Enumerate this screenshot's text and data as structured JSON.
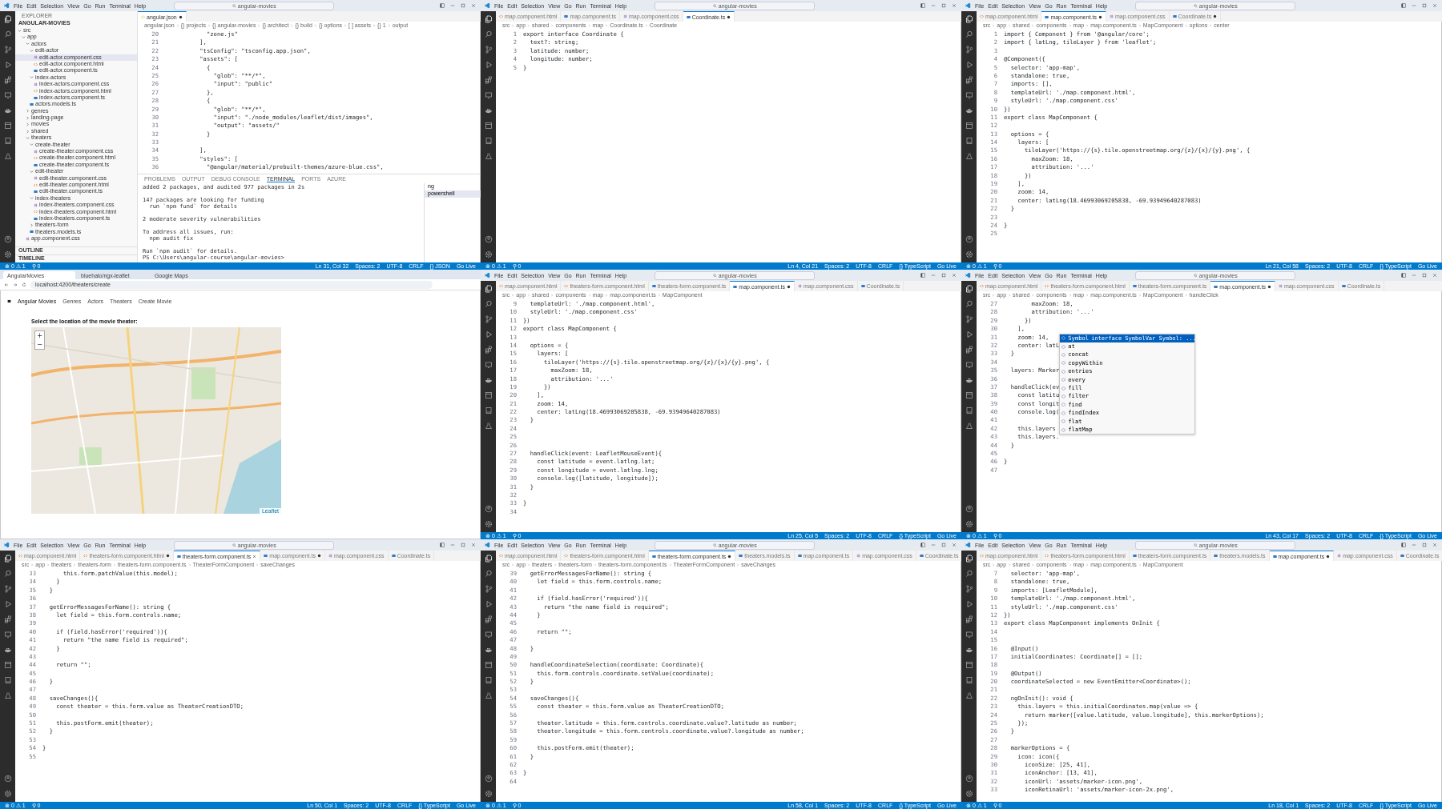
{
  "panels": [
    {
      "kind": "editor",
      "menu": [
        "File",
        "Edit",
        "Selection",
        "View",
        "Go",
        "Run",
        "Terminal",
        "Help"
      ],
      "command_center": "angular-movies",
      "tabs": [
        {
          "label": "angular.json",
          "kind": "json",
          "selected": true,
          "modified": true
        }
      ],
      "breadcrumb": [
        "angular.json",
        "{} projects",
        "{} angular-movies",
        "{} architect",
        "{} build",
        "{} options",
        "[ ] assets",
        "{} 1",
        "output"
      ],
      "explorer": {
        "title": "EXPLORER",
        "section": "ANGULAR-MOVIES",
        "tree": [
          {
            "name": "src",
            "kind": "folder",
            "expanded": true,
            "selected": false,
            "children": [
              {
                "name": "app",
                "kind": "folder",
                "expanded": true,
                "selected": false,
                "children": [
                  {
                    "name": "actors",
                    "kind": "folder",
                    "expanded": true,
                    "selected": false,
                    "children": [
                      {
                        "name": "edit-actor",
                        "kind": "folder",
                        "expanded": true,
                        "selected": false,
                        "children": [
                          {
                            "name": "edit-actor.component.css",
                            "kind": "css",
                            "selected": true
                          },
                          {
                            "name": "edit-actor.component.html",
                            "kind": "html",
                            "selected": false
                          },
                          {
                            "name": "edit-actor.component.ts",
                            "kind": "ts",
                            "selected": false
                          }
                        ]
                      },
                      {
                        "name": "index-actors",
                        "kind": "folder",
                        "expanded": true,
                        "selected": false,
                        "children": [
                          {
                            "name": "index-actors.component.css",
                            "kind": "css",
                            "selected": false
                          },
                          {
                            "name": "index-actors.component.html",
                            "kind": "html",
                            "selected": false
                          },
                          {
                            "name": "index-actors.component.ts",
                            "kind": "ts",
                            "selected": false
                          }
                        ]
                      },
                      {
                        "name": "actors.models.ts",
                        "kind": "ts",
                        "selected": false
                      }
                    ]
                  },
                  {
                    "name": "genres",
                    "kind": "folder",
                    "expanded": false,
                    "selected": false
                  },
                  {
                    "name": "landing-page",
                    "kind": "folder",
                    "expanded": false,
                    "selected": false
                  },
                  {
                    "name": "movies",
                    "kind": "folder",
                    "expanded": false,
                    "selected": false
                  },
                  {
                    "name": "shared",
                    "kind": "folder",
                    "expanded": false,
                    "selected": false
                  },
                  {
                    "name": "theaters",
                    "kind": "folder",
                    "expanded": true,
                    "selected": false,
                    "children": [
                      {
                        "name": "create-theater",
                        "kind": "folder",
                        "expanded": true,
                        "selected": false,
                        "children": [
                          {
                            "name": "create-theater.component.css",
                            "kind": "css",
                            "selected": false
                          },
                          {
                            "name": "create-theater.component.html",
                            "kind": "html",
                            "selected": false
                          },
                          {
                            "name": "create-theater.component.ts",
                            "kind": "ts",
                            "selected": false
                          }
                        ]
                      },
                      {
                        "name": "edit-theater",
                        "kind": "folder",
                        "expanded": true,
                        "selected": false,
                        "children": [
                          {
                            "name": "edit-theater.component.css",
                            "kind": "css",
                            "selected": false
                          },
                          {
                            "name": "edit-theater.component.html",
                            "kind": "html",
                            "selected": false
                          },
                          {
                            "name": "edit-theater.component.ts",
                            "kind": "ts",
                            "selected": false
                          }
                        ]
                      },
                      {
                        "name": "index-theaters",
                        "kind": "folder",
                        "expanded": true,
                        "selected": false,
                        "children": [
                          {
                            "name": "index-theaters.component.css",
                            "kind": "css",
                            "selected": false
                          },
                          {
                            "name": "index-theaters.component.html",
                            "kind": "html",
                            "selected": false
                          },
                          {
                            "name": "index-theaters.component.ts",
                            "kind": "ts",
                            "selected": false
                          }
                        ]
                      },
                      {
                        "name": "theaters-form",
                        "kind": "folder",
                        "expanded": false,
                        "selected": false
                      },
                      {
                        "name": "theaters.models.ts",
                        "kind": "ts",
                        "selected": false
                      }
                    ]
                  },
                  {
                    "name": "app.component.css",
                    "kind": "css",
                    "selected": false
                  }
                ]
              }
            ]
          }
        ],
        "footer": [
          "OUTLINE",
          "TIMELINE"
        ]
      },
      "lines": [
        {
          "n": "20",
          "code": "            \"zone.js\""
        },
        {
          "n": "21",
          "code": "          ],"
        },
        {
          "n": "22",
          "code": "          \"tsConfig\": \"tsconfig.app.json\","
        },
        {
          "n": "23",
          "code": "          \"assets\": ["
        },
        {
          "n": "24",
          "code": "            {"
        },
        {
          "n": "25",
          "code": "              \"glob\": \"**/*\","
        },
        {
          "n": "26",
          "code": "              \"input\": \"public\""
        },
        {
          "n": "27",
          "code": "            },"
        },
        {
          "n": "28",
          "code": "            {"
        },
        {
          "n": "29",
          "code": "              \"glob\": \"**/*\","
        },
        {
          "n": "30",
          "code": "              \"input\": \"./node_modules/leaflet/dist/images\","
        },
        {
          "n": "31",
          "code": "              \"output\": \"assets/\""
        },
        {
          "n": "32",
          "code": "            }"
        },
        {
          "n": "33"
        },
        {
          "n": "34",
          "code": "          ],"
        },
        {
          "n": "35",
          "code": "          \"styles\": ["
        },
        {
          "n": "36",
          "code": "            \"@angular/material/prebuilt-themes/azure-blue.css\","
        }
      ],
      "terminal": {
        "tabs": [
          {
            "label": "PROBLEMS",
            "selected": false
          },
          {
            "label": "OUTPUT",
            "selected": false
          },
          {
            "label": "DEBUG CONSOLE",
            "selected": false
          },
          {
            "label": "TERMINAL",
            "selected": true
          },
          {
            "label": "PORTS",
            "selected": false
          },
          {
            "label": "AZURE",
            "selected": false
          }
        ],
        "blocks": [
          [
            "added 2 packages, and audited 977 packages in 2s"
          ],
          [
            "147 packages are looking for funding",
            "  run `npm fund` for details"
          ],
          [
            "2 moderate severity vulnerabilities"
          ],
          [
            "To address all issues, run:",
            "  npm audit fix"
          ],
          [
            "Run `npm audit` for details.",
            "PS C:\\Users\\angular-course\\angular-movies> "
          ]
        ],
        "sessions": [
          {
            "label": "ng",
            "selected": false
          },
          {
            "label": "powershell",
            "selected": true
          }
        ]
      },
      "status_left": [
        "⊗ 0 ⚠ 1",
        "⚲ 0"
      ],
      "status_right": [
        "Ln 31, Col 32",
        "Spaces: 2",
        "UTF-8",
        "CRLF",
        "{} JSON",
        "Go Live"
      ]
    },
    {
      "kind": "editor",
      "menu": [
        "File",
        "Edit",
        "Selection",
        "View",
        "Go",
        "Run",
        "Terminal",
        "Help"
      ],
      "command_center": "angular-movies",
      "tabs": [
        {
          "label": "map.component.html",
          "kind": "html",
          "selected": false,
          "modified": false
        },
        {
          "label": "map.component.ts",
          "kind": "ts",
          "selected": false,
          "modified": false
        },
        {
          "label": "map.component.css",
          "kind": "css",
          "selected": false,
          "modified": false
        },
        {
          "label": "Coordinate.ts",
          "kind": "ts",
          "selected": true,
          "modified": true
        }
      ],
      "breadcrumb": [
        "src",
        "app",
        "shared",
        "components",
        "map",
        "Coordinate.ts",
        "Coordinate"
      ],
      "lines": [
        {
          "n": "1",
          "code": "export interface Coordinate {"
        },
        {
          "n": "2",
          "code": "  text?: string;"
        },
        {
          "n": "3",
          "code": "  latitude: number;"
        },
        {
          "n": "4",
          "code": "  longitude: number;"
        },
        {
          "n": "5",
          "code": "}"
        }
      ],
      "status_left": [
        "⊗ 0 ⚠ 1",
        "⚲ 0"
      ],
      "status_right": [
        "Ln 4, Col 21",
        "Spaces: 2",
        "UTF-8",
        "CRLF",
        "{} TypeScript",
        "Go Live"
      ]
    },
    {
      "kind": "editor",
      "menu": [
        "File",
        "Edit",
        "Selection",
        "View",
        "Go",
        "Run",
        "Terminal",
        "Help"
      ],
      "command_center": "angular-movies",
      "tabs": [
        {
          "label": "map.component.html",
          "kind": "html",
          "selected": false,
          "modified": false
        },
        {
          "label": "map.component.ts",
          "kind": "ts",
          "selected": true,
          "modified": true
        },
        {
          "label": "map.component.css",
          "kind": "css",
          "selected": false,
          "modified": false
        },
        {
          "label": "Coordinate.ts",
          "kind": "ts",
          "selected": false,
          "modified": true
        }
      ],
      "breadcrumb": [
        "src",
        "app",
        "shared",
        "components",
        "map",
        "map.component.ts",
        "MapComponent",
        "options",
        "center"
      ],
      "lines": [
        {
          "n": "1",
          "code": "import { Component } from '@angular/core';"
        },
        {
          "n": "2",
          "code": "import { latLng, tileLayer } from 'leaflet';"
        },
        {
          "n": "3"
        },
        {
          "n": "4",
          "code": "@Component({"
        },
        {
          "n": "5",
          "code": "  selector: 'app-map',"
        },
        {
          "n": "6",
          "code": "  standalone: true,"
        },
        {
          "n": "7",
          "code": "  imports: [],"
        },
        {
          "n": "8",
          "code": "  templateUrl: './map.component.html',"
        },
        {
          "n": "9",
          "code": "  styleUrl: './map.component.css'"
        },
        {
          "n": "10",
          "code": "})"
        },
        {
          "n": "11",
          "code": "export class MapComponent {"
        },
        {
          "n": "12"
        },
        {
          "n": "13",
          "code": "  options = {"
        },
        {
          "n": "14",
          "code": "    layers: ["
        },
        {
          "n": "15",
          "code": "      tileLayer('https://{s}.tile.openstreetmap.org/{z}/{x}/{y}.png', {"
        },
        {
          "n": "16",
          "code": "        maxZoom: 18,"
        },
        {
          "n": "17",
          "code": "        attribution: '...'"
        },
        {
          "n": "18",
          "code": "      })"
        },
        {
          "n": "19",
          "code": "    ],"
        },
        {
          "n": "20",
          "code": "    zoom: 14,"
        },
        {
          "n": "21",
          "code": "    center: latLng(18.46993069205838, -69.93949640287083)"
        },
        {
          "n": "22",
          "code": "  }"
        },
        {
          "n": "23"
        },
        {
          "n": "24",
          "code": "}"
        },
        {
          "n": "25"
        }
      ],
      "status_left": [
        "⊗ 0 ⚠ 1",
        "⚲ 0"
      ],
      "status_right": [
        "Ln 21, Col 58",
        "Spaces: 2",
        "UTF-8",
        "CRLF",
        "{} TypeScript",
        "Go Live"
      ]
    },
    {
      "kind": "browser",
      "tabs": [
        {
          "label": "AngularMovies",
          "selected": true
        },
        {
          "label": "bluehalo/ngx-leaflet",
          "selected": false
        },
        {
          "label": "Google Maps",
          "selected": false
        }
      ],
      "address": "localhost:4200/theaters/create",
      "nav": [
        "Angular Movies",
        "Genres",
        "Actors",
        "Theaters",
        "Create Movie"
      ],
      "heading": "Select the location of the movie theater:",
      "map": {
        "kind": "picture",
        "zoom_in": "+",
        "zoom_out": "−",
        "attribution": "Leaflet"
      }
    },
    {
      "kind": "editor",
      "menu": [
        "File",
        "Edit",
        "Selection",
        "View",
        "Go",
        "Run",
        "Terminal",
        "Help"
      ],
      "command_center": "angular-movies",
      "tabs": [
        {
          "label": "map.component.html",
          "kind": "html",
          "selected": false,
          "modified": false
        },
        {
          "label": "theaters-form.component.html",
          "kind": "html",
          "selected": false,
          "modified": false
        },
        {
          "label": "theaters-form.component.ts",
          "kind": "ts",
          "selected": false,
          "modified": false
        },
        {
          "label": "map.component.ts",
          "kind": "ts",
          "selected": true,
          "modified": true
        },
        {
          "label": "map.component.css",
          "kind": "css",
          "selected": false,
          "modified": false
        },
        {
          "label": "Coordinate.ts",
          "kind": "ts",
          "selected": false,
          "modified": false
        }
      ],
      "breadcrumb": [
        "src",
        "app",
        "shared",
        "components",
        "map",
        "map.component.ts",
        "MapComponent"
      ],
      "lines": [
        {
          "n": "9",
          "code": "  templateUrl: './map.component.html',"
        },
        {
          "n": "10",
          "code": "  styleUrl: './map.component.css'"
        },
        {
          "n": "11",
          "code": "})"
        },
        {
          "n": "12",
          "code": "export class MapComponent {"
        },
        {
          "n": "13"
        },
        {
          "n": "14",
          "code": "  options = {"
        },
        {
          "n": "15",
          "code": "    layers: ["
        },
        {
          "n": "16",
          "code": "      tileLayer('https://{s}.tile.openstreetmap.org/{z}/{x}/{y}.png', {"
        },
        {
          "n": "17",
          "code": "        maxZoom: 18,"
        },
        {
          "n": "18",
          "code": "        attribution: '...'"
        },
        {
          "n": "19",
          "code": "      })"
        },
        {
          "n": "20",
          "code": "    ],"
        },
        {
          "n": "21",
          "code": "    zoom: 14,"
        },
        {
          "n": "22",
          "code": "    center: latLng(18.46993069205838, -69.93949640287083)"
        },
        {
          "n": "23",
          "code": "  }"
        },
        {
          "n": "24"
        },
        {
          "n": "25"
        },
        {
          "n": "26"
        },
        {
          "n": "27",
          "code": "  handleClick(event: LeafletMouseEvent){"
        },
        {
          "n": "28",
          "code": "    const latitude = event.latlng.lat;"
        },
        {
          "n": "29",
          "code": "    const longitude = event.latlng.lng;"
        },
        {
          "n": "30",
          "code": "    console.log([latitude, longitude]);"
        },
        {
          "n": "31",
          "code": "  }"
        },
        {
          "n": "32"
        },
        {
          "n": "33",
          "code": "}"
        },
        {
          "n": "34"
        }
      ],
      "status_left": [
        "⊗ 0 ⚠ 1",
        "⚲ 0"
      ],
      "status_right": [
        "Ln 25, Col 5",
        "Spaces: 2",
        "UTF-8",
        "CRLF",
        "{} TypeScript",
        "Go Live"
      ]
    },
    {
      "kind": "editor",
      "menu": [
        "File",
        "Edit",
        "Selection",
        "View",
        "Go",
        "Run",
        "Terminal",
        "Help"
      ],
      "command_center": "angular-movies",
      "tabs": [
        {
          "label": "map.component.html",
          "kind": "html",
          "selected": false,
          "modified": false
        },
        {
          "label": "theaters-form.component.html",
          "kind": "html",
          "selected": false,
          "modified": false
        },
        {
          "label": "theaters-form.component.ts",
          "kind": "ts",
          "selected": false,
          "modified": false
        },
        {
          "label": "map.component.ts",
          "kind": "ts",
          "selected": true,
          "modified": true
        },
        {
          "label": "map.component.css",
          "kind": "css",
          "selected": false,
          "modified": false
        },
        {
          "label": "Coordinate.ts",
          "kind": "ts",
          "selected": false,
          "modified": false
        }
      ],
      "breadcrumb": [
        "src",
        "app",
        "shared",
        "components",
        "map",
        "map.component.ts",
        "MapComponent",
        "handleClick"
      ],
      "lines": [
        {
          "n": "27",
          "code": "        maxZoom: 18,"
        },
        {
          "n": "28",
          "code": "        attribution: '...'"
        },
        {
          "n": "29",
          "code": "      })"
        },
        {
          "n": "30",
          "code": "    ],"
        },
        {
          "n": "31",
          "code": "    zoom: 14,"
        },
        {
          "n": "32",
          "code": "    center: latL"
        },
        {
          "n": "33",
          "code": "  }"
        },
        {
          "n": "34"
        },
        {
          "n": "35",
          "code": "  layers: Marker"
        },
        {
          "n": "36"
        },
        {
          "n": "37",
          "code": "  handleClick(ev"
        },
        {
          "n": "38",
          "code": "    const latitu"
        },
        {
          "n": "39",
          "code": "    const longit"
        },
        {
          "n": "40",
          "code": "    console.log("
        },
        {
          "n": "41"
        },
        {
          "n": "42",
          "code": "    this.layers"
        },
        {
          "n": "43",
          "code": "    this.layers."
        },
        {
          "n": "44",
          "code": "  }"
        },
        {
          "n": "45"
        },
        {
          "n": "46",
          "code": "}"
        },
        {
          "n": "47"
        }
      ],
      "suggest": {
        "detail": "interface SymbolVar Symbol: ...",
        "items": [
          {
            "label": "Symbol",
            "selected": true
          },
          {
            "label": "at",
            "selected": false
          },
          {
            "label": "concat",
            "selected": false
          },
          {
            "label": "copyWithin",
            "selected": false
          },
          {
            "label": "entries",
            "selected": false
          },
          {
            "label": "every",
            "selected": false
          },
          {
            "label": "fill",
            "selected": false
          },
          {
            "label": "filter",
            "selected": false
          },
          {
            "label": "find",
            "selected": false
          },
          {
            "label": "findIndex",
            "selected": false
          },
          {
            "label": "flat",
            "selected": false
          },
          {
            "label": "flatMap",
            "selected": false
          }
        ]
      },
      "status_left": [
        "⊗ 0 ⚠ 1",
        "⚲ 0"
      ],
      "status_right": [
        "Ln 43, Col 17",
        "Spaces: 2",
        "UTF-8",
        "CRLF",
        "{} TypeScript",
        "Go Live"
      ]
    },
    {
      "kind": "editor",
      "menu": [
        "File",
        "Edit",
        "Selection",
        "View",
        "Go",
        "Run",
        "Terminal",
        "Help"
      ],
      "command_center": "angular-movies",
      "tabs": [
        {
          "label": "map.component.html",
          "kind": "html",
          "selected": false,
          "modified": false
        },
        {
          "label": "theaters-form.component.html",
          "kind": "html",
          "selected": false,
          "modified": true
        },
        {
          "label": "theaters-form.component.ts",
          "kind": "ts",
          "selected": true,
          "modified": false
        },
        {
          "label": "map.component.ts",
          "kind": "ts",
          "selected": false,
          "modified": true
        },
        {
          "label": "map.component.css",
          "kind": "css",
          "selected": false,
          "modified": false
        },
        {
          "label": "Coordinate.ts",
          "kind": "ts",
          "selected": false,
          "modified": false
        }
      ],
      "breadcrumb": [
        "src",
        "app",
        "theaters",
        "theaters-form",
        "theaters-form.component.ts",
        "TheaterFormComponent",
        "saveChanges"
      ],
      "lines": [
        {
          "n": "33",
          "code": "      this.form.patchValue(this.model);"
        },
        {
          "n": "34",
          "code": "    }"
        },
        {
          "n": "35",
          "code": "  }"
        },
        {
          "n": "36"
        },
        {
          "n": "37",
          "code": "  getErrorMessagesForName(): string {"
        },
        {
          "n": "38",
          "code": "    let field = this.form.controls.name;"
        },
        {
          "n": "39"
        },
        {
          "n": "40",
          "code": "    if (field.hasError('required')){"
        },
        {
          "n": "41",
          "code": "      return \"the name field is required\";"
        },
        {
          "n": "42",
          "code": "    }"
        },
        {
          "n": "43"
        },
        {
          "n": "44",
          "code": "    return \"\";"
        },
        {
          "n": "45"
        },
        {
          "n": "46",
          "code": "  }"
        },
        {
          "n": "47"
        },
        {
          "n": "48",
          "code": "  saveChanges(){"
        },
        {
          "n": "49",
          "code": "    const theater = this.form.value as TheaterCreationDTO;"
        },
        {
          "n": "50"
        },
        {
          "n": "51",
          "code": "    this.postForm.emit(theater);"
        },
        {
          "n": "52",
          "code": "  }"
        },
        {
          "n": "53"
        },
        {
          "n": "54",
          "code": "}"
        },
        {
          "n": "55"
        }
      ],
      "status_left": [
        "⊗ 0 ⚠ 1",
        "⚲ 0"
      ],
      "status_right": [
        "Ln 50, Col 1",
        "Spaces: 2",
        "UTF-8",
        "CRLF",
        "{} TypeScript",
        "Go Live"
      ]
    },
    {
      "kind": "editor",
      "menu": [
        "File",
        "Edit",
        "Selection",
        "View",
        "Go",
        "Run",
        "Terminal",
        "Help"
      ],
      "command_center": "angular-movies",
      "tabs": [
        {
          "label": "map.component.html",
          "kind": "html",
          "selected": false,
          "modified": false
        },
        {
          "label": "theaters-form.component.html",
          "kind": "html",
          "selected": false,
          "modified": false
        },
        {
          "label": "theaters-form.component.ts",
          "kind": "ts",
          "selected": true,
          "modified": true
        },
        {
          "label": "theaters.models.ts",
          "kind": "ts",
          "selected": false,
          "modified": false
        },
        {
          "label": "map.component.ts",
          "kind": "ts",
          "selected": false,
          "modified": false
        },
        {
          "label": "map.component.css",
          "kind": "css",
          "selected": false,
          "modified": false
        },
        {
          "label": "Coordinate.ts",
          "kind": "ts",
          "selected": false,
          "modified": false
        }
      ],
      "breadcrumb": [
        "src",
        "app",
        "theaters",
        "theaters-form",
        "theaters-form.component.ts",
        "TheaterFormComponent",
        "saveChanges"
      ],
      "lines": [
        {
          "n": "39",
          "code": "  getErrorMessagesForName(): string {"
        },
        {
          "n": "40",
          "code": "    let field = this.form.controls.name;"
        },
        {
          "n": "41"
        },
        {
          "n": "42",
          "code": "    if (field.hasError('required')){"
        },
        {
          "n": "43",
          "code": "      return \"the name field is required\";"
        },
        {
          "n": "44",
          "code": "    }"
        },
        {
          "n": "45"
        },
        {
          "n": "46",
          "code": "    return \"\";"
        },
        {
          "n": "47"
        },
        {
          "n": "48",
          "code": "  }"
        },
        {
          "n": "49"
        },
        {
          "n": "50",
          "code": "  handleCoordinateSelection(coordinate: Coordinate){"
        },
        {
          "n": "51",
          "code": "    this.form.controls.coordinate.setValue(coordinate);"
        },
        {
          "n": "52",
          "code": "  }"
        },
        {
          "n": "53"
        },
        {
          "n": "54",
          "code": "  saveChanges(){"
        },
        {
          "n": "55",
          "code": "    const theater = this.form.value as TheaterCreationDTO;"
        },
        {
          "n": "56"
        },
        {
          "n": "57",
          "code": "    theater.latitude = this.form.controls.coordinate.value?.latitude as number;"
        },
        {
          "n": "58",
          "code": "    theater.longitude = this.form.controls.coordinate.value?.longitude as number;"
        },
        {
          "n": "59"
        },
        {
          "n": "60",
          "code": "    this.postForm.emit(theater);"
        },
        {
          "n": "61",
          "code": "  }"
        },
        {
          "n": "62"
        },
        {
          "n": "63",
          "code": "}"
        },
        {
          "n": "64"
        }
      ],
      "status_left": [
        "⊗ 0 ⚠ 1",
        "⚲ 0"
      ],
      "status_right": [
        "Ln 58, Col 1",
        "Spaces: 2",
        "UTF-8",
        "CRLF",
        "{} TypeScript",
        "Go Live"
      ]
    },
    {
      "kind": "editor",
      "menu": [
        "File",
        "Edit",
        "Selection",
        "View",
        "Go",
        "Run",
        "Terminal",
        "Help"
      ],
      "command_center": "angular-movies",
      "tabs": [
        {
          "label": "map.component.html",
          "kind": "html",
          "selected": false,
          "modified": false
        },
        {
          "label": "theaters-form.component.html",
          "kind": "html",
          "selected": false,
          "modified": false
        },
        {
          "label": "theaters-form.component.ts",
          "kind": "ts",
          "selected": false,
          "modified": false
        },
        {
          "label": "theaters.models.ts",
          "kind": "ts",
          "selected": false,
          "modified": false
        },
        {
          "label": "map.component.ts",
          "kind": "ts",
          "selected": true,
          "modified": true
        },
        {
          "label": "map.component.css",
          "kind": "css",
          "selected": false,
          "modified": false
        },
        {
          "label": "Coordinate.ts",
          "kind": "ts",
          "selected": false,
          "modified": false
        }
      ],
      "breadcrumb": [
        "src",
        "app",
        "shared",
        "components",
        "map",
        "map.component.ts",
        "MapComponent"
      ],
      "lines": [
        {
          "n": "7",
          "code": "  selector: 'app-map',"
        },
        {
          "n": "8",
          "code": "  standalone: true,"
        },
        {
          "n": "9",
          "code": "  imports: [LeafletModule],"
        },
        {
          "n": "10",
          "code": "  templateUrl: './map.component.html',"
        },
        {
          "n": "11",
          "code": "  styleUrl: './map.component.css'"
        },
        {
          "n": "12",
          "code": "})"
        },
        {
          "n": "13",
          "code": "export class MapComponent implements OnInit {"
        },
        {
          "n": "14"
        },
        {
          "n": "15"
        },
        {
          "n": "16",
          "code": "  @Input()"
        },
        {
          "n": "17",
          "code": "  initialCoordinates: Coordinate[] = [];"
        },
        {
          "n": "18"
        },
        {
          "n": "19",
          "code": "  @Output()"
        },
        {
          "n": "20",
          "code": "  coordinateSelected = new EventEmitter<Coordinate>();"
        },
        {
          "n": "21"
        },
        {
          "n": "22",
          "code": "  ngOnInit(): void {"
        },
        {
          "n": "23",
          "code": "    this.layers = this.initialCoordinates.map(value => {"
        },
        {
          "n": "24",
          "code": "      return marker([value.latitude, value.longitude], this.markerOptions);"
        },
        {
          "n": "25",
          "code": "    });"
        },
        {
          "n": "26",
          "code": "  }"
        },
        {
          "n": "27"
        },
        {
          "n": "28",
          "code": "  markerOptions = {"
        },
        {
          "n": "29",
          "code": "    icon: icon({"
        },
        {
          "n": "30",
          "code": "      iconSize: [25, 41],"
        },
        {
          "n": "31",
          "code": "      iconAnchor: [13, 41],"
        },
        {
          "n": "32",
          "code": "      iconUrl: 'assets/marker-icon.png',"
        },
        {
          "n": "33",
          "code": "      iconRetinaUrl: 'assets/marker-icon-2x.png',"
        }
      ],
      "status_left": [
        "⊗ 0 ⚠ 1",
        "⚲ 0"
      ],
      "status_right": [
        "Ln 18, Col 1",
        "Spaces: 2",
        "UTF-8",
        "CRLF",
        "{} TypeScript",
        "Go Live"
      ]
    }
  ]
}
